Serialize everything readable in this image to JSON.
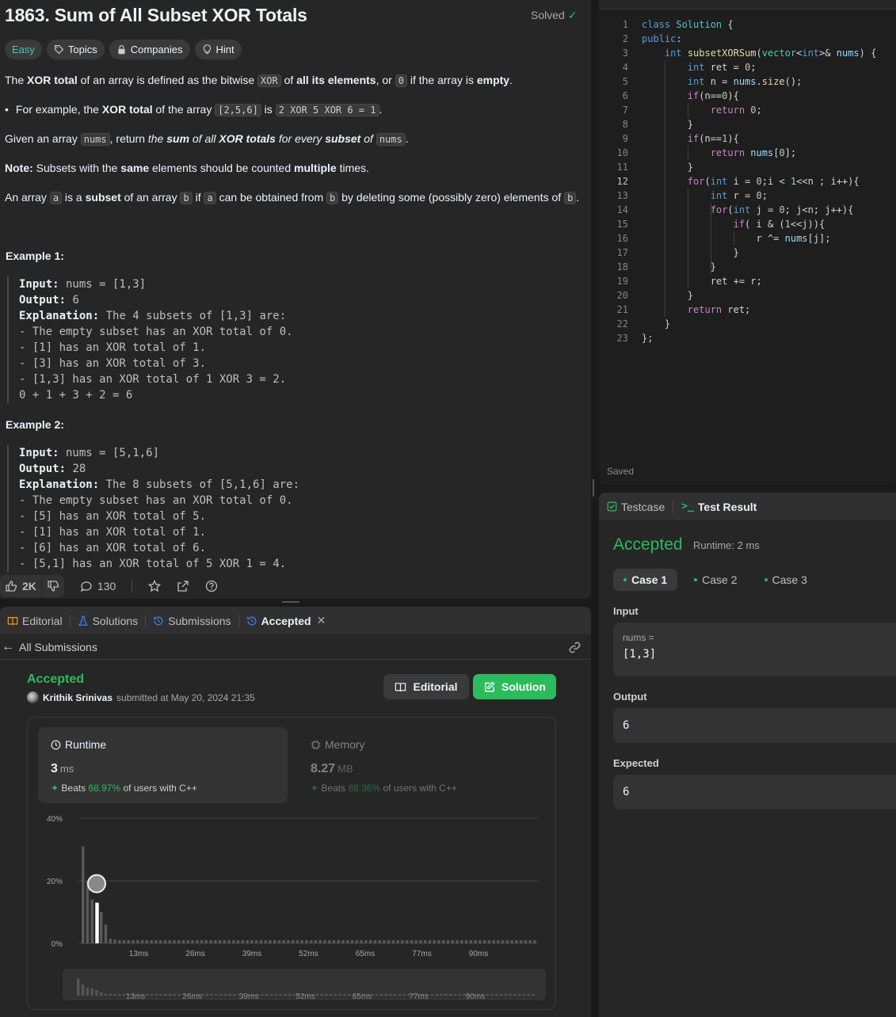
{
  "problem": {
    "title": "1863. Sum of All Subset XOR Totals",
    "solved_label": "Solved",
    "tags": {
      "difficulty": "Easy",
      "topics": "Topics",
      "companies": "Companies",
      "hint": "Hint"
    },
    "p1": {
      "a": "The ",
      "b": "XOR total",
      "c": " of an array is defined as the bitwise ",
      "code1": "XOR",
      "d": " of ",
      "e": "all its elements",
      "f": ", or ",
      "code2": "0",
      "g": " if the array is ",
      "h": "empty",
      "i": "."
    },
    "bullet": {
      "a": "For example, the ",
      "b": "XOR total",
      "c": " of the array ",
      "code1": "[2,5,6]",
      "d": " is ",
      "code2": "2 XOR 5 XOR 6 = 1",
      "e": "."
    },
    "p2": {
      "a": "Given an array ",
      "code1": "nums",
      "b": ", return ",
      "c": "the ",
      "d": "sum",
      "e": " of all ",
      "f": "XOR totals",
      "g": " for every ",
      "h": "subset",
      "i": " of ",
      "code2": "nums",
      "j": "."
    },
    "note": {
      "a": "Note:",
      "b": " Subsets with the ",
      "c": "same",
      "d": " elements should be counted ",
      "e": "multiple",
      "f": " times."
    },
    "p3": {
      "a": "An array ",
      "code1": "a",
      "b": " is a ",
      "c": "subset",
      "d": " of an array ",
      "code2": "b",
      "e": " if ",
      "code3": "a",
      "f": " can be obtained from ",
      "code4": "b",
      "g": " by deleting some (possibly zero) elements of ",
      "code5": "b",
      "h": "."
    },
    "example1": {
      "title": "Example 1:",
      "input_label": "Input:",
      "input": " nums = [1,3]",
      "output_label": "Output:",
      "output": " 6",
      "expl_label": "Explanation:",
      "expl": " The 4 subsets of [1,3] are:",
      "lines": [
        "- The empty subset has an XOR total of 0.",
        "- [1] has an XOR total of 1.",
        "- [3] has an XOR total of 3.",
        "- [1,3] has an XOR total of 1 XOR 3 = 2.",
        "0 + 1 + 3 + 2 = 6"
      ]
    },
    "example2": {
      "title": "Example 2:",
      "input_label": "Input:",
      "input": " nums = [5,1,6]",
      "output_label": "Output:",
      "output": " 28",
      "expl_label": "Explanation:",
      "expl": " The 8 subsets of [5,1,6] are:",
      "lines": [
        "- The empty subset has an XOR total of 0.",
        "- [5] has an XOR total of 5.",
        "- [1] has an XOR total of 1.",
        "- [6] has an XOR total of 6.",
        "- [5,1] has an XOR total of 5 XOR 1 = 4."
      ]
    },
    "likes": "2K",
    "comments": "130"
  },
  "editor": {
    "code_lines": [
      "class Solution {",
      "public:",
      "    int subsetXORSum(vector<int>& nums) {",
      "        int ret = 0;",
      "        int n = nums.size();",
      "        if(n==0){",
      "            return 0;",
      "        }",
      "        if(n==1){",
      "            return nums[0];",
      "        }",
      "        for(int i = 0;i < 1<<n ; i++){",
      "            int r = 0;",
      "            for(int j = 0; j<n; j++){",
      "                if( i & (1<<j)){",
      "                    r ^= nums[j];",
      "                }",
      "            }",
      "            ret += r;",
      "        }",
      "        return ret;",
      "    }",
      "};"
    ],
    "current_line": 12,
    "status": "Saved"
  },
  "testpanel": {
    "tab_testcase": "Testcase",
    "tab_result": "Test Result",
    "verdict": "Accepted",
    "runtime": "Runtime: 2 ms",
    "cases": [
      "Case 1",
      "Case 2",
      "Case 3"
    ],
    "input_label": "Input",
    "input_var": "nums =",
    "input_value": "[1,3]",
    "output_label": "Output",
    "output_value": "6",
    "expected_label": "Expected",
    "expected_value": "6"
  },
  "submission": {
    "tabs": [
      "Editorial",
      "Solutions",
      "Submissions",
      "Accepted"
    ],
    "back_label": "All Submissions",
    "verdict": "Accepted",
    "user": "Krithik Srinivas",
    "submitted": "submitted at May 20, 2024 21:35",
    "editorial_btn": "Editorial",
    "solution_btn": "Solution",
    "runtime_title": "Runtime",
    "runtime_value": "3",
    "runtime_unit": "ms",
    "runtime_beats_pre": "Beats ",
    "runtime_beats": "68.97%",
    "runtime_beats_post": " of users with C++",
    "memory_title": "Memory",
    "memory_value": "8.27",
    "memory_unit": "MB",
    "memory_beats_pre": "Beats ",
    "memory_beats": "88.36%",
    "memory_beats_post": " of users with C++"
  },
  "colors": {
    "accent_green": "#2cbb5d",
    "easy_teal": "#46c6c2"
  },
  "chart_data": {
    "type": "bar",
    "xlabel": "",
    "ylabel": "",
    "ylim": [
      0,
      40
    ],
    "yticks": [
      "0%",
      "20%",
      "40%"
    ],
    "xticks": [
      "13ms",
      "26ms",
      "39ms",
      "52ms",
      "65ms",
      "77ms",
      "90ms"
    ],
    "x_start_ms": 0,
    "x_step_ms": 1,
    "values": [
      31,
      20,
      14,
      13,
      10,
      6,
      1.5,
      1.2,
      1,
      1,
      1,
      1,
      1,
      1,
      1,
      1,
      1,
      1,
      1,
      1,
      1,
      1,
      1,
      1,
      1,
      1,
      1,
      1,
      1,
      1,
      1,
      1,
      1,
      1,
      1,
      1,
      1,
      1,
      1,
      1,
      1,
      1,
      1,
      1,
      1,
      1,
      1,
      1,
      1,
      1,
      1,
      1,
      1,
      1,
      1,
      1,
      1,
      1,
      1,
      1,
      1,
      1,
      1,
      1,
      1,
      1,
      1,
      1,
      1,
      1,
      1,
      1,
      1,
      1,
      1,
      1,
      1,
      1,
      1,
      1,
      1,
      1,
      1,
      1,
      1,
      1,
      1,
      1,
      1,
      1,
      1,
      1,
      1,
      1,
      1,
      1,
      1,
      1,
      1,
      1
    ],
    "highlight_index": 3,
    "grid": true
  }
}
